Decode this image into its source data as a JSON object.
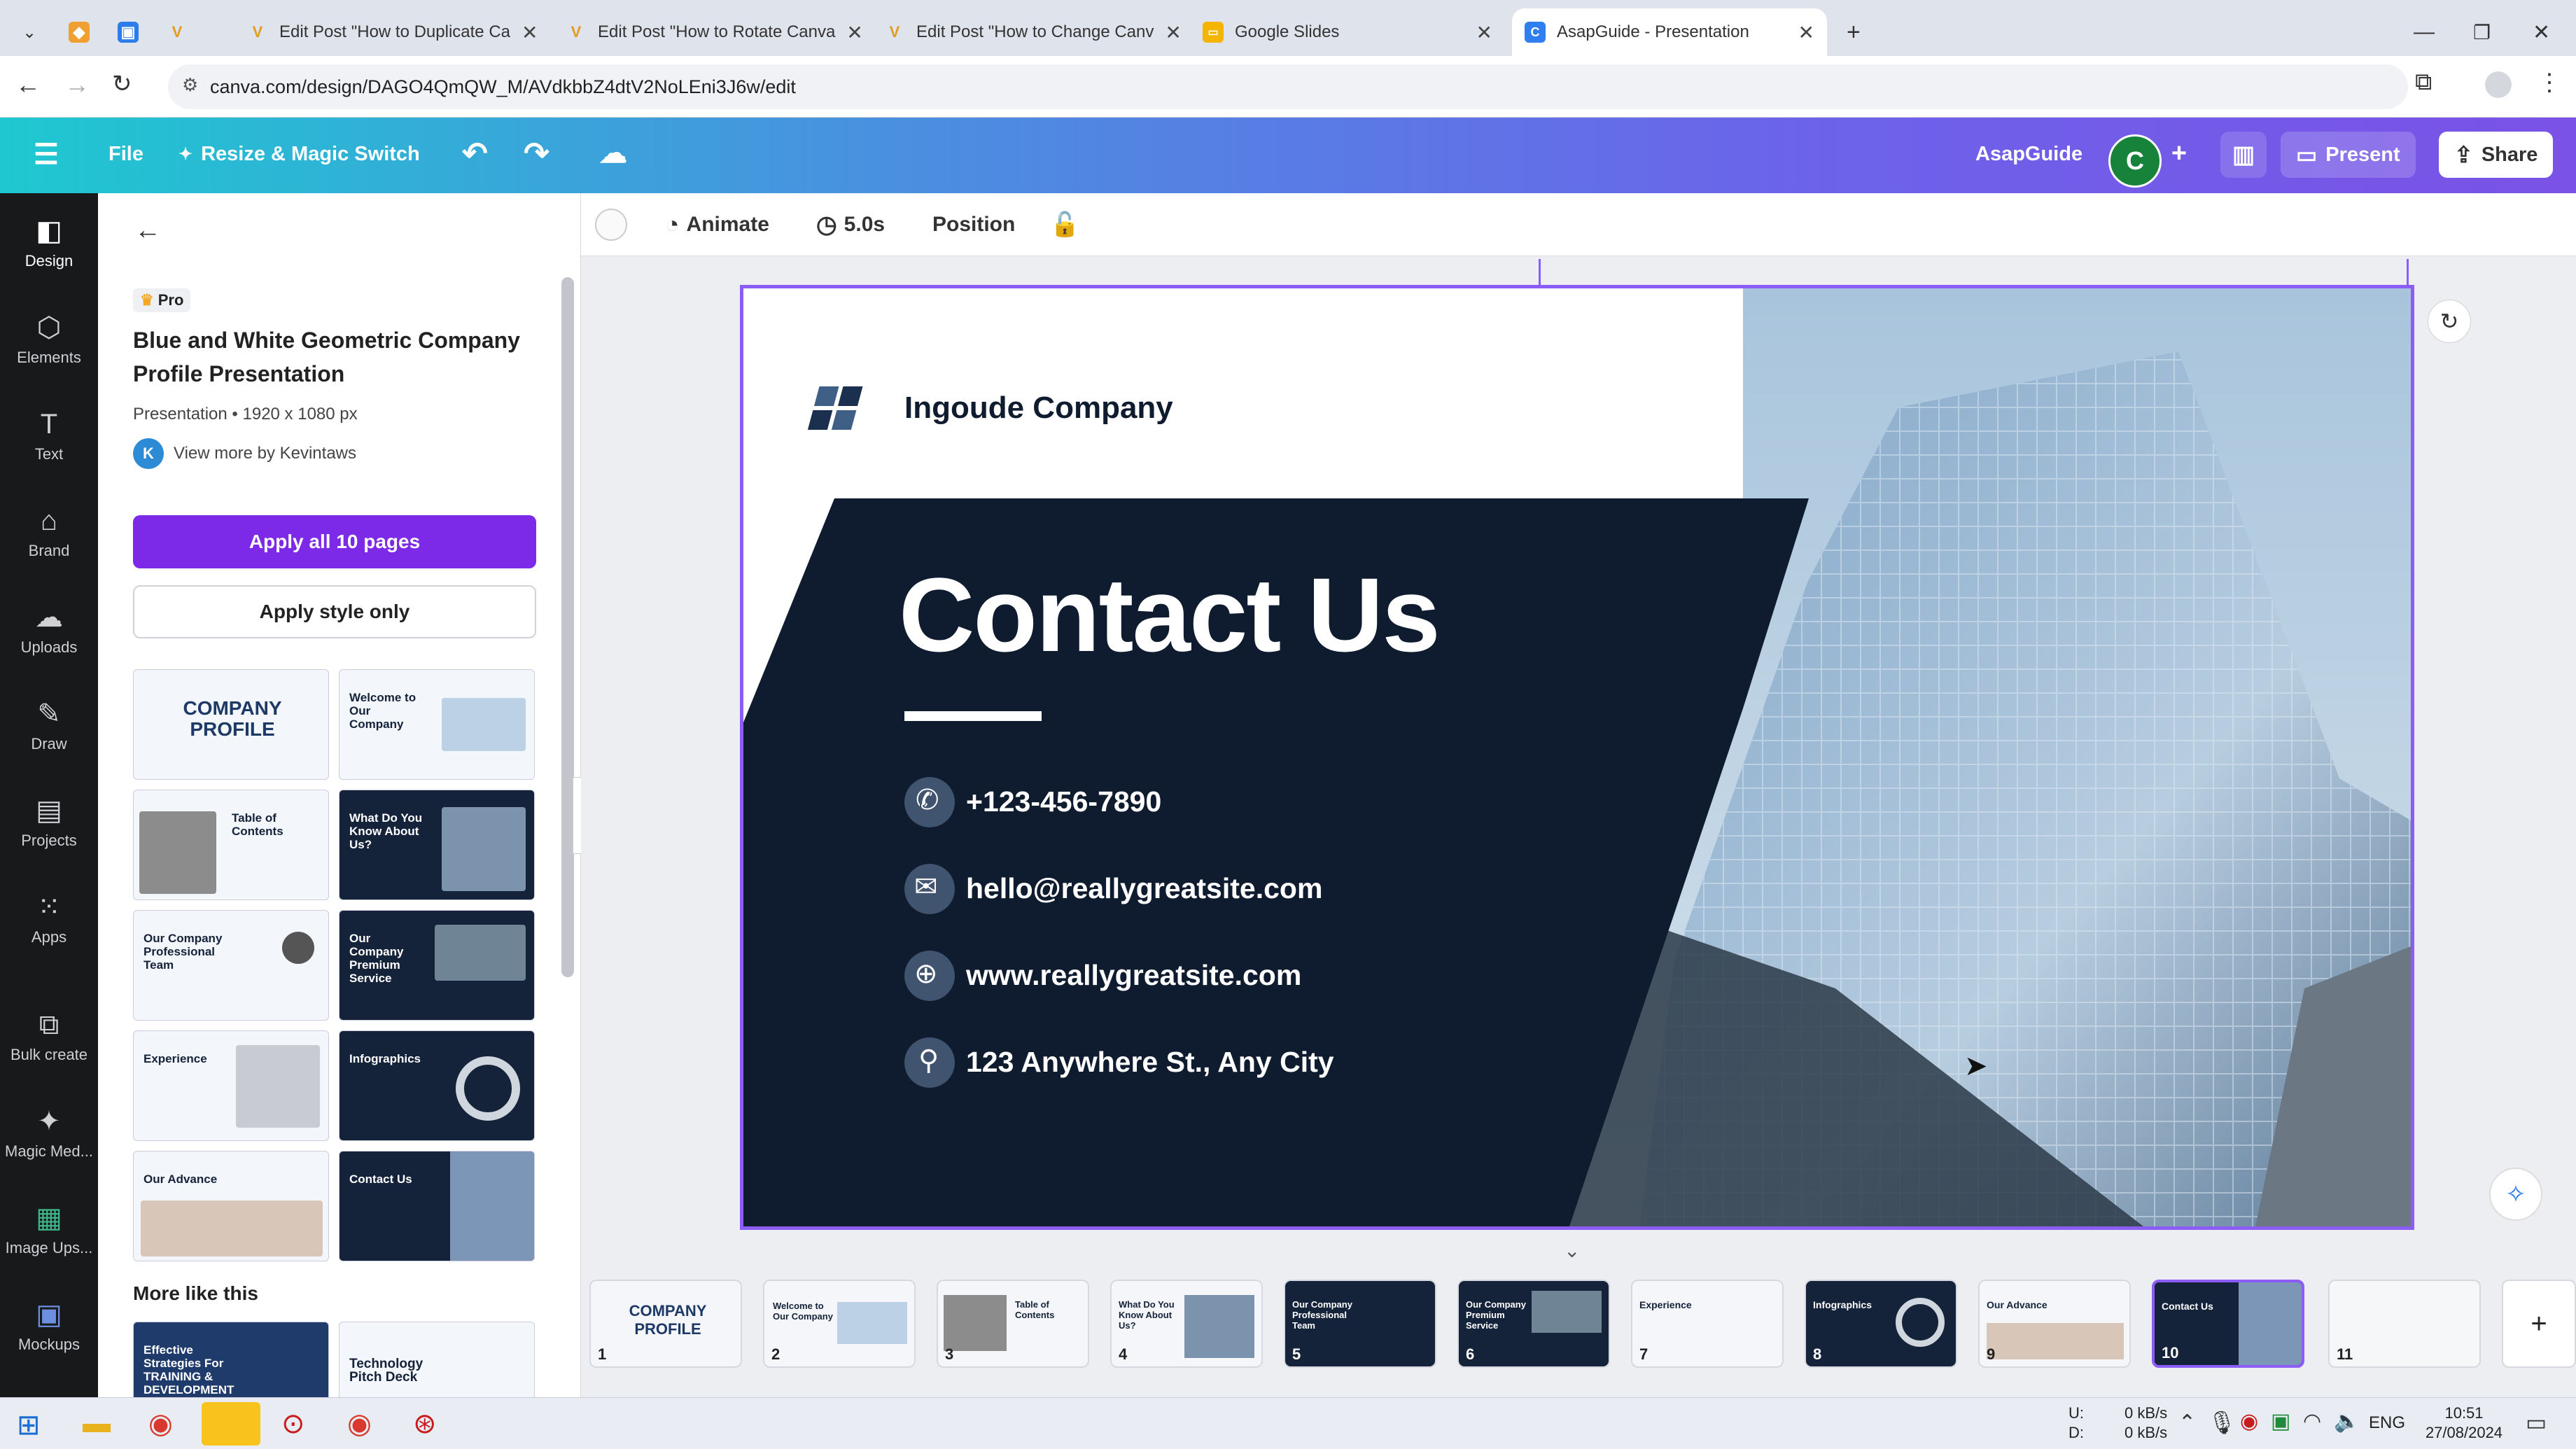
{
  "browser": {
    "tabs": [
      {
        "title": "",
        "icon": "tab-groups-icon"
      },
      {
        "title": "",
        "icon": "pinned-app-icon"
      },
      {
        "title": "",
        "icon": "pinned-app-icon"
      },
      {
        "title": "",
        "icon": "v-site-icon"
      },
      {
        "title": "Edit Post \"How to Duplicate Ca",
        "icon": "v-site-icon"
      },
      {
        "title": "Edit Post \"How to Rotate Canva",
        "icon": "v-site-icon"
      },
      {
        "title": "Edit Post \"How to Change Canv",
        "icon": "v-site-icon"
      },
      {
        "title": "Google Slides",
        "icon": "slides-icon"
      },
      {
        "title": "AsapGuide - Presentation",
        "icon": "canva-icon"
      }
    ],
    "url": "canva.com/design/DAGO4QmQW_M/AVdkbbZ4dtV2NoLEni3J6w/edit"
  },
  "header": {
    "file_label": "File",
    "resize_label": "Resize & Magic Switch",
    "team_name": "AsapGuide",
    "avatar_letter": "C",
    "present_label": "Present",
    "share_label": "Share"
  },
  "rail": [
    {
      "label": "Design",
      "icon": "design-icon"
    },
    {
      "label": "Elements",
      "icon": "elements-icon"
    },
    {
      "label": "Text",
      "icon": "text-icon"
    },
    {
      "label": "Brand",
      "icon": "brand-icon"
    },
    {
      "label": "Uploads",
      "icon": "uploads-icon"
    },
    {
      "label": "Draw",
      "icon": "draw-icon"
    },
    {
      "label": "Projects",
      "icon": "projects-icon"
    },
    {
      "label": "Apps",
      "icon": "apps-icon"
    },
    {
      "label": "Bulk create",
      "icon": "bulk-create-icon"
    },
    {
      "label": "Magic Med...",
      "icon": "magic-media-icon"
    },
    {
      "label": "Image Ups...",
      "icon": "image-upscaler-icon"
    },
    {
      "label": "Mockups",
      "icon": "mockups-icon"
    }
  ],
  "panel": {
    "pro_badge": "Pro",
    "template_title": "Blue and White Geometric Company Profile Presentation",
    "template_meta": "Presentation • 1920 x 1080 px",
    "author_initial": "K",
    "author_link": "View more by Kevintaws",
    "apply_all_label": "Apply all 10 pages",
    "apply_style_label": "Apply style only",
    "thumbs": [
      {
        "title": "COMPANY PROFILE",
        "light": true
      },
      {
        "title": "Welcome to Our Company",
        "light": true
      },
      {
        "title": "Table of Contents",
        "light": true
      },
      {
        "title": "What Do You Know About Us?",
        "light": false
      },
      {
        "title": "Our Company Professional Team",
        "light": true
      },
      {
        "title": "Our Company Premium Service",
        "light": false
      },
      {
        "title": "Experience",
        "light": true
      },
      {
        "title": "Infographics",
        "light": false
      },
      {
        "title": "Our Advance",
        "light": true
      },
      {
        "title": "Contact Us",
        "light": false
      }
    ],
    "more_like_this": "More like this",
    "more_thumbs": [
      {
        "title": "Effective Strategies For TRAINING & DEVELOPMENT"
      },
      {
        "title": "Technology Pitch Deck"
      }
    ]
  },
  "toolbar": {
    "animate_label": "Animate",
    "duration_label": "5.0s",
    "position_label": "Position"
  },
  "slide": {
    "company": "Ingoude Company",
    "heading": "Contact Us",
    "phone": "+123-456-7890",
    "email": "hello@reallygreatsite.com",
    "website": "www.reallygreatsite.com",
    "address": "123 Anywhere St., Any City"
  },
  "filmstrip": [
    {
      "n": "1",
      "title": "COMPANY PROFILE",
      "light": true
    },
    {
      "n": "2",
      "title": "Welcome to Our Company",
      "light": true
    },
    {
      "n": "3",
      "title": "Table of Contents",
      "light": true
    },
    {
      "n": "4",
      "title": "What Do You Know About Us?",
      "light": true
    },
    {
      "n": "5",
      "title": "Our Company Professional Team",
      "light": false
    },
    {
      "n": "6",
      "title": "Our Company Premium Service",
      "light": false
    },
    {
      "n": "7",
      "title": "Experience",
      "light": true
    },
    {
      "n": "8",
      "title": "Infographics",
      "light": false
    },
    {
      "n": "9",
      "title": "Our Advance",
      "light": true
    },
    {
      "n": "10",
      "title": "Contact Us",
      "light": false
    },
    {
      "n": "11",
      "title": "",
      "light": true
    }
  ],
  "taskbar": {
    "net_up_label": "U:",
    "net_down_label": "D:",
    "net_up": "0 kB/s",
    "net_down": "0 kB/s",
    "lang": "ENG",
    "time": "10:51",
    "date": "27/08/2024"
  },
  "colors": {
    "accent": "#7d2ae8",
    "navy": "#0f1b2e",
    "selection": "#8b5cf6"
  }
}
